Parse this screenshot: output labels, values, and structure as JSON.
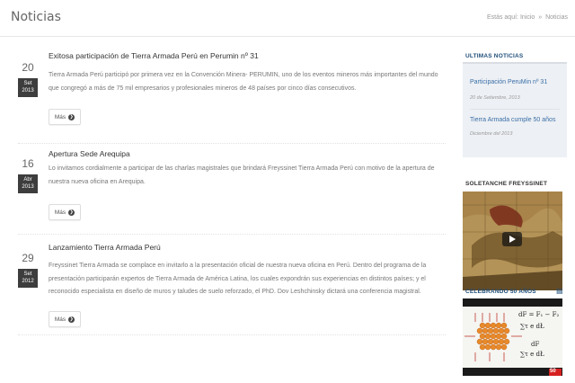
{
  "header": {
    "title": "Noticias",
    "breadcrumb": {
      "prefix": "Estás aquí:",
      "home": "Inicio",
      "separator": "»",
      "current": "Noticias"
    }
  },
  "posts": [
    {
      "day": "20",
      "month": "Set",
      "year": "2013",
      "title": "Exitosa participación de Tierra Armada Perú en Perumin nº 31",
      "excerpt": "Tierra Armada Perú participó por primera vez en la Convención Minera- PERUMIN, uno de los eventos mineros más importantes del mundo que congregó a más de 75 mil empresarios y profesionales mineros de 48 países por cinco días consecutivos.",
      "more_label": "Más"
    },
    {
      "day": "16",
      "month": "Abr",
      "year": "2013",
      "title": "Apertura Sede Arequipa",
      "excerpt": "Lo invitamos cordialmente a participar de las charlas magistrales que brindará Freyssinet Tierra Armada Perú con motivo de la apertura de nuestra nueva oficina en Arequipa.",
      "more_label": "Más"
    },
    {
      "day": "29",
      "month": "Set",
      "year": "2012",
      "title": "Lanzamiento Tierra Armada Perú",
      "excerpt": "Freyssinet Tierra Armada se complace en invitarlo a la presentación oficial de nuestra nueva oficina en Perú. Dentro del programa de la presentación participarán expertos de Tierra Armada de América Latina, los cuales expondrán sus experiencias en distintos países; y el reconocido especialista en diseño de muros y taludes de suelo reforzado, el PhD. Dov Leshchinsky dictará una conferencia magistral.",
      "more_label": "Más"
    }
  ],
  "sidebar": {
    "latest_title": "ULTIMAS NOTICIAS",
    "latest": [
      {
        "title": "Participación PeruMin nº 31",
        "date": "20 de Setiembre, 2013"
      },
      {
        "title": "Tierra Armada cumple 50 años",
        "date": "Diciembre del 2013"
      }
    ],
    "video1_title": "SOLETANCHE FREYSSINET",
    "video2_title": "CELEBRANDO 50 AÑOS",
    "video2_formulas": [
      "dF = F₁ − F₂",
      "∑τ e dŁ",
      "dF",
      "∑τ e dŁ"
    ],
    "video2_badge": "50",
    "colors": {
      "link": "#3a6fa8",
      "widget_title_blue": "#1f4e79",
      "date_badge": "#3d3d3d"
    }
  }
}
